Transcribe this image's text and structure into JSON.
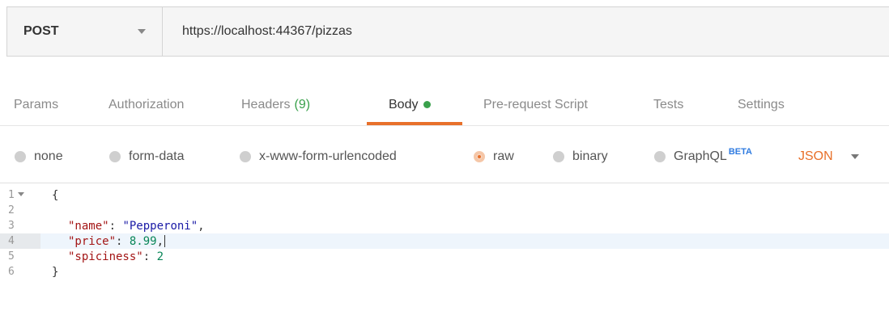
{
  "request": {
    "method": "POST",
    "url": "https://localhost:44367/pizzas"
  },
  "tabs": [
    {
      "label": "Params"
    },
    {
      "label": "Authorization"
    },
    {
      "label": "Headers",
      "count": "(9)"
    },
    {
      "label": "Body",
      "active": true
    },
    {
      "label": "Pre-request Script"
    },
    {
      "label": "Tests"
    },
    {
      "label": "Settings"
    }
  ],
  "body_options": {
    "items": [
      {
        "label": "none"
      },
      {
        "label": "form-data"
      },
      {
        "label": "x-www-form-urlencoded"
      },
      {
        "label": "raw",
        "checked": true
      },
      {
        "label": "binary"
      },
      {
        "label": "GraphQL",
        "badge": "BETA"
      }
    ],
    "content_type": "JSON"
  },
  "editor": {
    "lines": [
      {
        "num": "1",
        "fold": true,
        "open": "{"
      },
      {
        "num": "2"
      },
      {
        "num": "3",
        "key": "\"name\"",
        "sep": ": ",
        "value": "\"Pepperoni\"",
        "tail": ","
      },
      {
        "num": "4",
        "key": "\"price\"",
        "sep": ": ",
        "number": "8.99",
        "tail": ",",
        "current": true
      },
      {
        "num": "5",
        "key": "\"spiciness\"",
        "sep": ": ",
        "number": "2"
      },
      {
        "num": "6",
        "close": "}"
      }
    ]
  },
  "colors": {
    "accent": "#e8702a",
    "green": "#3aa14c",
    "beta": "#2f7be0"
  }
}
